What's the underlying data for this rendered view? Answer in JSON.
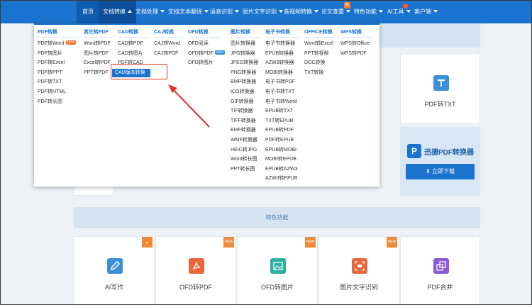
{
  "nav": {
    "items": [
      {
        "label": "首页"
      },
      {
        "label": "文档转换"
      },
      {
        "label": "文档处理"
      },
      {
        "label": "文档文本翻译"
      },
      {
        "label": "语音识别"
      },
      {
        "label": "图片文字识别"
      },
      {
        "label": "音视频转换"
      },
      {
        "label": "论文查重"
      },
      {
        "label": "特色功能"
      },
      {
        "label": "AI工具"
      },
      {
        "label": "客户端"
      }
    ],
    "new_badge": "新"
  },
  "dropdown": {
    "columns": [
      {
        "title": "PDF转换",
        "items": [
          "PDF转Word",
          "PDF转图片",
          "PDF转Excel",
          "PDF转PPT",
          "PDF转TXT",
          "PDF转HTML",
          "PDF转长图"
        ]
      },
      {
        "title": "其它转PDF",
        "items": [
          "Word转PDF",
          "图片转PDF",
          "Excel转PDF",
          "PPT转PDF"
        ]
      },
      {
        "title": "CAD转换",
        "items": [
          "CAD转PDF",
          "CAD转图片",
          "PDF转CAD",
          "CAD版本转换"
        ]
      },
      {
        "title": "CAJ转换",
        "items": [
          "CAJ转Word",
          "CAJ转PDF"
        ]
      },
      {
        "title": "OFD转换",
        "items": [
          "OFD阅读",
          "OFD转PDF",
          "OFD转图片"
        ]
      },
      {
        "title": "图片转换",
        "items": [
          "图片转换器",
          "JPG转换器",
          "JPEG转换器",
          "PNG转换器",
          "BMP转换器",
          "ICO转换器",
          "GIF转换器",
          "TIF转换器",
          "TIFF转换器",
          "EMF转换器",
          "WMF转换器",
          "HEIC转JPG",
          "Word转长图",
          "PPT转长图"
        ]
      },
      {
        "title": "电子书转换",
        "items": [
          "电子书转换器",
          "EPUB转换器",
          "AZW3转换器",
          "MOBI转换器",
          "电子书转PDF",
          "电子书转TXT",
          "电子书转Word",
          "EPUB转TXT",
          "TXT转EPUB",
          "EPUB转PDF",
          "PDF转EPUB",
          "EPUB转MOBI",
          "MOBI转EPUB",
          "EPUB转AZW3",
          "AZW3转EPUB"
        ]
      },
      {
        "title": "OFFICE转换",
        "items": [
          "Word转Excel",
          "PPT转视频",
          "DOC转换",
          "TXT转换"
        ]
      },
      {
        "title": "WPS转换",
        "items": [
          "WPS转Office",
          "WPS转PDF"
        ]
      }
    ],
    "new_tag": "NEW",
    "highlight_label": "CAD版本转换"
  },
  "background": {
    "right_card_label": "PDF转TXT",
    "promo_title": "迅捷PDF转换器",
    "promo_button": "立即下载",
    "section_title": "特色功能",
    "feature_tiles": [
      {
        "label": "AI写作"
      },
      {
        "label": "OFD转PDF"
      },
      {
        "label": "OFD转图片"
      },
      {
        "label": "图片文字识别"
      },
      {
        "label": "PDF合并"
      }
    ]
  },
  "colors": {
    "nav_bg": "#1a73ce",
    "accent": "#1a73ce",
    "annotation": "#e0322a",
    "new_badge": "#ff6a2a"
  }
}
